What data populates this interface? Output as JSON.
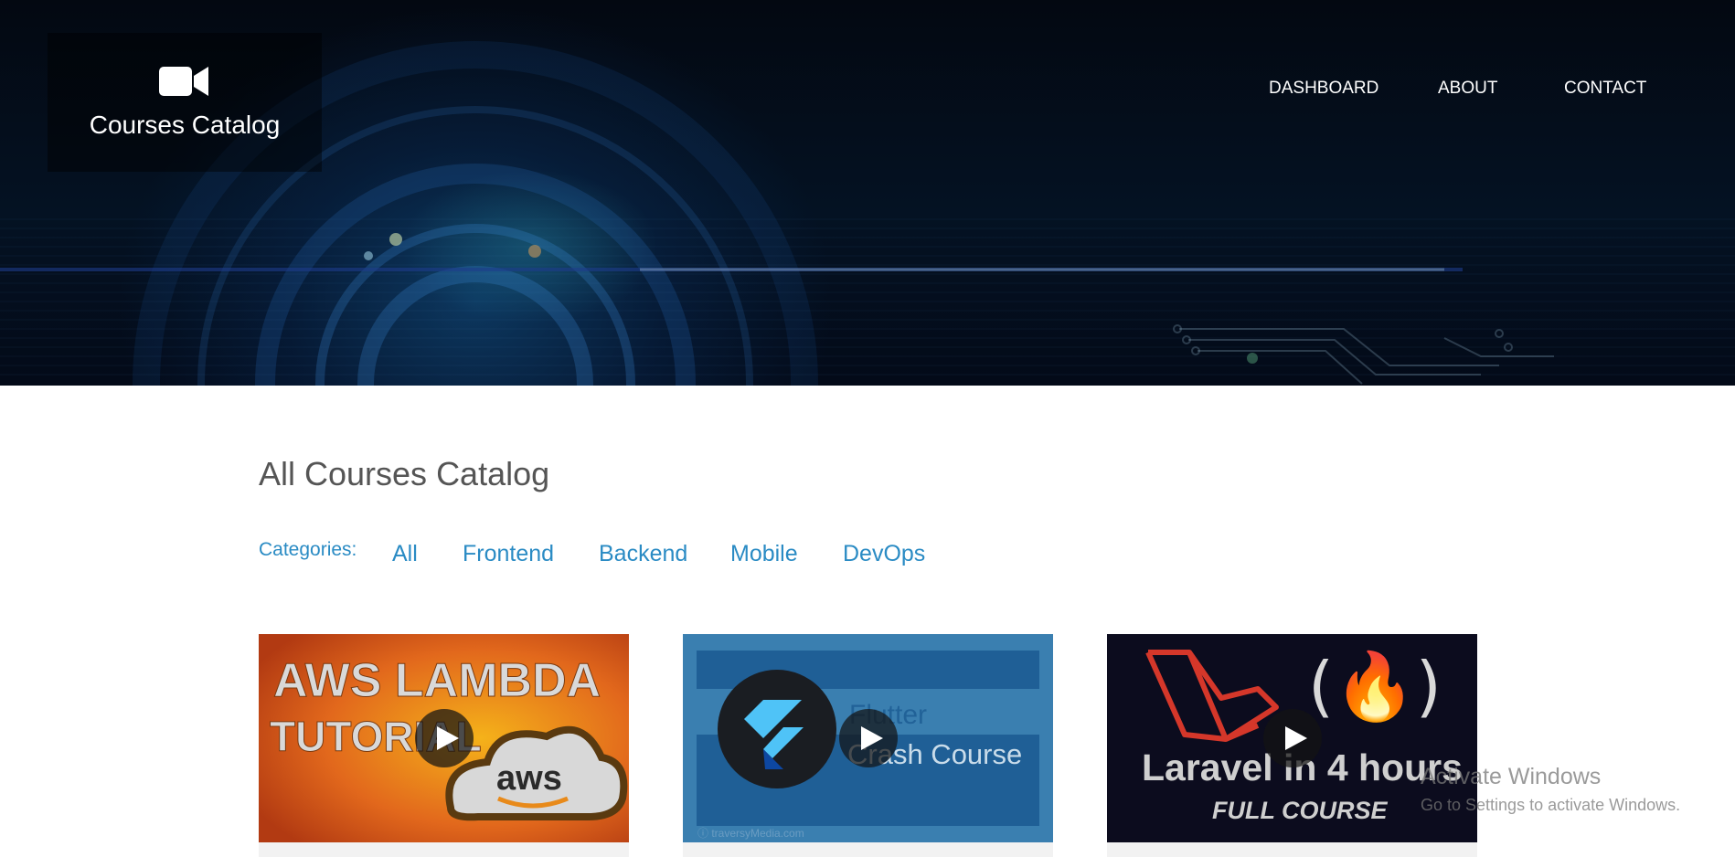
{
  "header": {
    "brand_title": "Courses Catalog",
    "brand_icon": "video-camera-icon",
    "nav": [
      {
        "label": "DASHBOARD"
      },
      {
        "label": "ABOUT"
      },
      {
        "label": "CONTACT"
      }
    ]
  },
  "main": {
    "heading": "All Courses Catalog",
    "categories_label": "Categories:",
    "categories": [
      "All",
      "Frontend",
      "Backend",
      "Mobile",
      "DevOps"
    ],
    "courses": [
      {
        "thumb_line1": "AWS LAMBDA",
        "thumb_line2": "TUTORIAL",
        "thumb_badge": "aws",
        "icon": "play-icon"
      },
      {
        "thumb_line1": "Flutter",
        "thumb_line2": "Crash Course",
        "thumb_credit": "ⓘ traversyMedia.com",
        "icon": "play-icon"
      },
      {
        "thumb_line1": "Laravel in 4 hours",
        "thumb_line2": "FULL COURSE",
        "thumb_logo": "(🔥)",
        "icon": "play-icon"
      }
    ]
  },
  "watermark": {
    "title": "Activate Windows",
    "subtitle": "Go to Settings to activate Windows."
  },
  "colors": {
    "accent": "#2a8bc4",
    "heading": "#555555",
    "hero_bg": "#041223"
  }
}
